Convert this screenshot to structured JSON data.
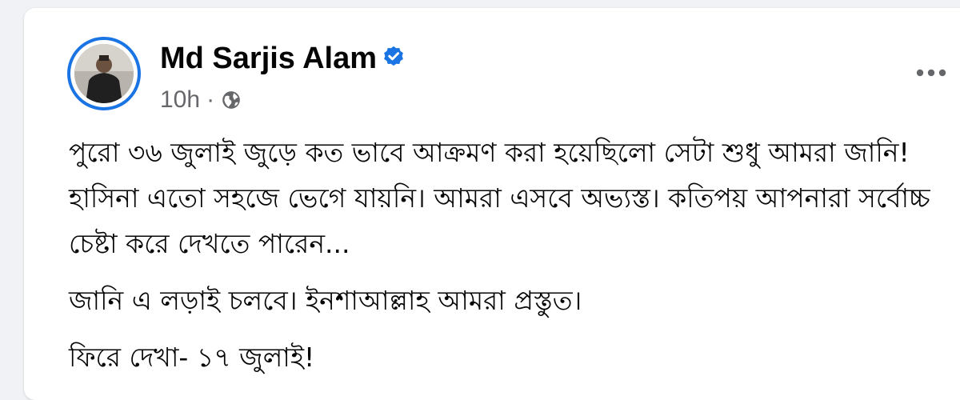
{
  "post": {
    "author": "Md Sarjis Alam",
    "time": "10h",
    "separator": "·",
    "audience_icon": "globe-icon",
    "verified_icon": "verified-badge-icon",
    "more_icon": "more-options-icon",
    "paragraphs": [
      "পুরো ৩৬ জুলাই জুড়ে কত ভাবে আক্রমণ করা হয়েছিলো সেটা শুধু আমরা জানি!\nহাসিনা এতো সহজে ভেগে যায়নি। আমরা এসবে অভ্যস্ত। কতিপয় আপনারা সর্বোচ্চ\nচেষ্টা করে দেখতে পারেন...",
      "জানি এ লড়াই চলবে। ইনশাআল্লাহ আমরা প্রস্তুত।",
      "ফিরে দেখা- ১৭ জুলাই!"
    ]
  },
  "colors": {
    "brand_blue": "#1b74e4",
    "text_primary": "#050505",
    "text_secondary": "#65676b",
    "page_background": "#f0f2f5"
  }
}
